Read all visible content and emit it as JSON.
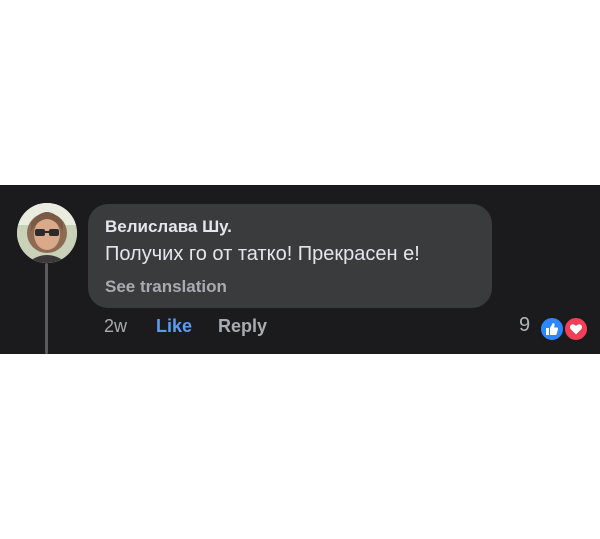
{
  "comment": {
    "author": "Велислава Шу.",
    "text": "Получих го от татко! Прекрасен е!",
    "see_translation": "See translation",
    "timestamp": "2w",
    "like_label": "Like",
    "reply_label": "Reply",
    "reaction_count": "9",
    "reactions": [
      "like-icon",
      "love-icon"
    ]
  },
  "colors": {
    "panel_bg": "#1b1b1d",
    "bubble_bg": "#3a3b3d",
    "like_accent": "#5b9bf8",
    "love_red": "#f33e58"
  }
}
